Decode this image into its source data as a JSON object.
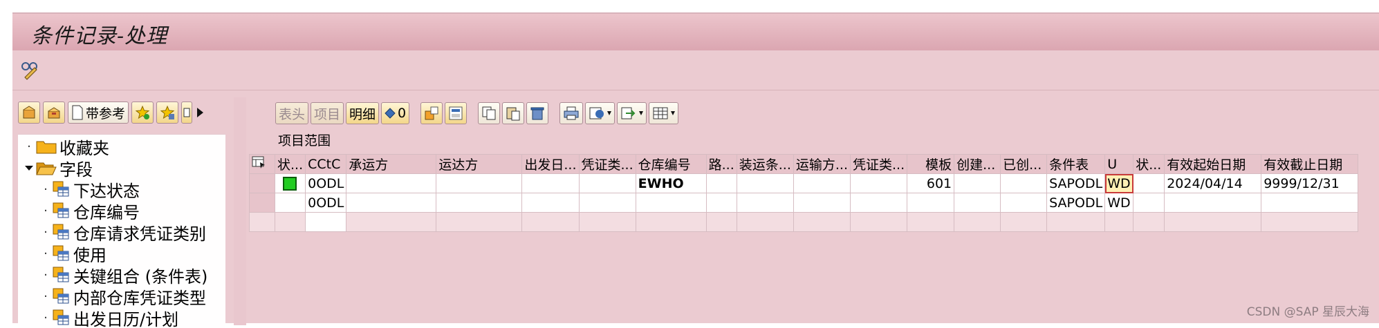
{
  "window": {
    "title": "条件记录-处理"
  },
  "left_toolbar": {
    "with_reference_label": "带参考"
  },
  "tree": {
    "items": [
      {
        "label": "收藏夹",
        "kind": "folder",
        "level": 0,
        "state": "collapsed"
      },
      {
        "label": "字段",
        "kind": "folder",
        "level": 0,
        "state": "expanded"
      },
      {
        "label": "下达状态",
        "kind": "field",
        "level": 1
      },
      {
        "label": "仓库编号",
        "kind": "field",
        "level": 1
      },
      {
        "label": "仓库请求凭证类别",
        "kind": "field",
        "level": 1
      },
      {
        "label": "使用",
        "kind": "field",
        "level": 1
      },
      {
        "label": "关键组合 (条件表)",
        "kind": "field",
        "level": 1
      },
      {
        "label": "内部仓库凭证类型",
        "kind": "field",
        "level": 1
      },
      {
        "label": "出发日历/计划",
        "kind": "field",
        "level": 1
      }
    ]
  },
  "grid_toolbar": {
    "header_label": "表头",
    "item_label": "项目",
    "detail_label": "明细",
    "count_value": "0"
  },
  "section": {
    "title": "项目范围"
  },
  "table": {
    "columns": [
      "状...",
      "CCtC",
      "承运方",
      "运达方",
      "出发日...",
      "凭证类...",
      "仓库编号",
      "路...",
      "装运条...",
      "运输方...",
      "凭证类...",
      "模板",
      "创建...",
      "已创...",
      "条件表",
      "U",
      "状...",
      "有效起始日期",
      "有效截止日期"
    ],
    "rows": [
      [
        "",
        "0ODL",
        "",
        "",
        "",
        "",
        "EWHO",
        "",
        "",
        "",
        "",
        "601",
        "",
        "",
        "SAPODL",
        "WD",
        "",
        "2024/04/14",
        "9999/12/31"
      ],
      [
        "",
        "0ODL",
        "",
        "",
        "",
        "",
        "",
        "",
        "",
        "",
        "",
        "",
        "",
        "",
        "SAPODL",
        "WD",
        "",
        "",
        ""
      ]
    ],
    "row_status_colors": [
      "#22cc22",
      ""
    ]
  },
  "watermark": "CSDN @SAP 星辰大海"
}
